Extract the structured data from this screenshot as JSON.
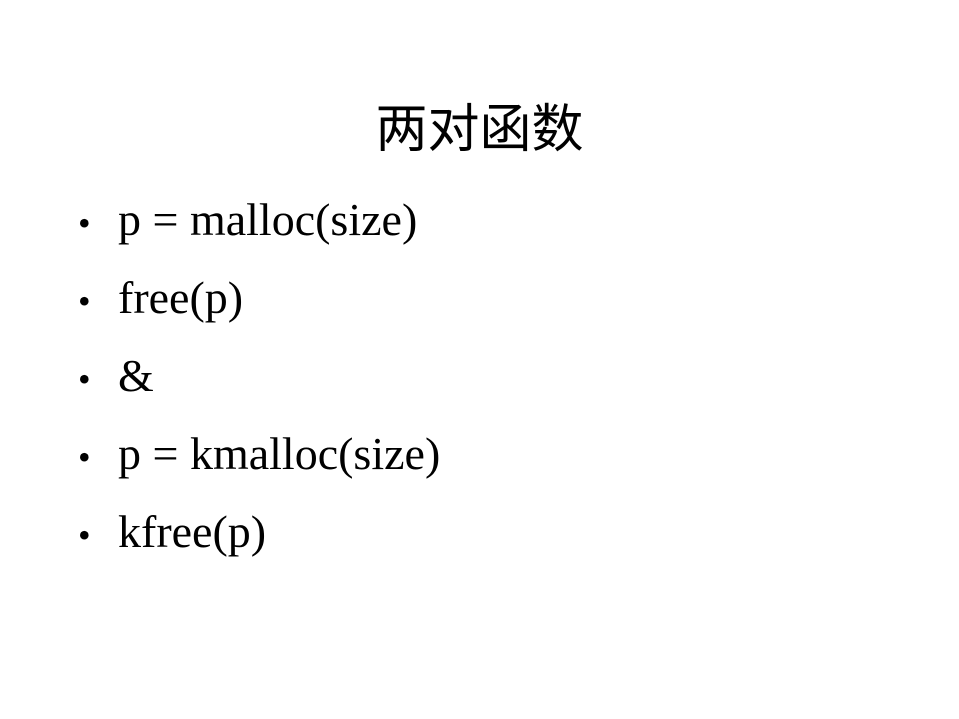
{
  "slide": {
    "title": "两对函数",
    "bullet_symbol": "•",
    "bullets": [
      {
        "text": "p = malloc(size)"
      },
      {
        "text": "free(p)"
      },
      {
        "text": "&"
      },
      {
        "text": "p = kmalloc(size)"
      },
      {
        "text": "kfree(p)"
      }
    ]
  }
}
